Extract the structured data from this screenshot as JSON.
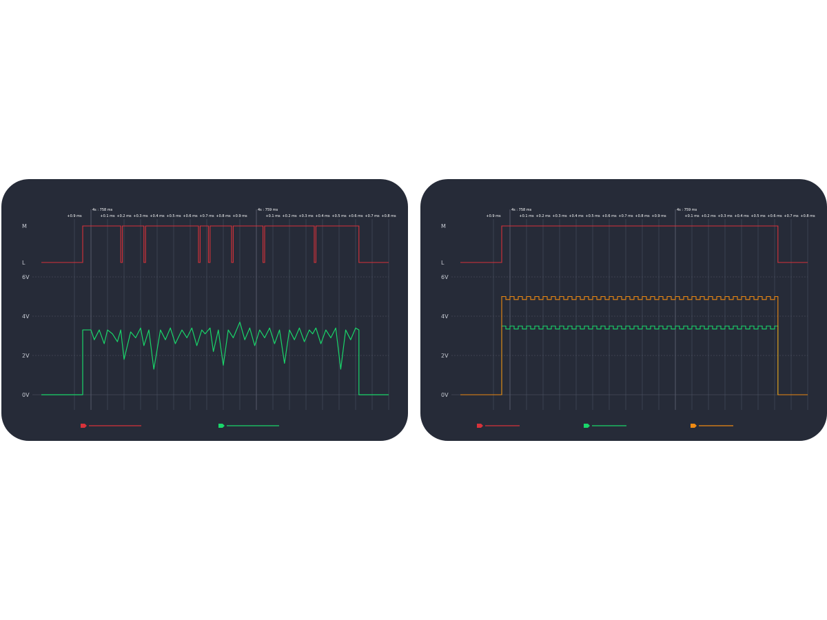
{
  "chart_data": [
    {
      "type": "line",
      "title": "",
      "time_axis": {
        "ticks_prev": [
          "+0.9 ms"
        ],
        "marker_1": "4s : 758 ms",
        "ticks_1": [
          "+0.1 ms",
          "+0.2 ms",
          "+0.3 ms",
          "+0.4 ms",
          "+0.5 ms",
          "+0.6 ms",
          "+0.7 ms",
          "+0.8 ms",
          "+0.9 ms"
        ],
        "marker_2": "4s : 759 ms",
        "ticks_2": [
          "+0.1 ms",
          "+0.2 ms",
          "+0.3 ms",
          "+0.4 ms",
          "+0.5 ms",
          "+0.6 ms",
          "+0.7 ms",
          "+0.8 ms"
        ]
      },
      "digital_axis": {
        "labels": [
          "M",
          "L"
        ]
      },
      "voltage_axis": {
        "labels": [
          "6V",
          "4V",
          "2V",
          "0V"
        ],
        "ylim": [
          0,
          6
        ]
      },
      "digital_series": {
        "color": "#d8323a",
        "x_ms": [
          -0.3,
          -0.05,
          -0.05,
          0.0,
          0.18,
          0.18,
          0.19,
          0.19,
          0.32,
          0.32,
          0.33,
          0.33,
          0.65,
          0.65,
          0.66,
          0.66,
          0.71,
          0.71,
          0.72,
          0.72,
          0.85,
          0.85,
          0.86,
          0.86,
          1.04,
          1.04,
          1.05,
          1.05,
          1.35,
          1.35,
          1.36,
          1.36,
          1.62,
          1.62,
          1.8
        ],
        "levels": [
          "L",
          "L",
          "M",
          "M",
          "M",
          "L",
          "L",
          "M",
          "M",
          "L",
          "L",
          "M",
          "M",
          "L",
          "L",
          "M",
          "M",
          "L",
          "L",
          "M",
          "M",
          "L",
          "L",
          "M",
          "M",
          "L",
          "L",
          "M",
          "M",
          "L",
          "L",
          "M",
          "M",
          "L",
          "L"
        ]
      },
      "analog_series": {
        "color": "#19d66a",
        "x_ms": [
          -0.3,
          -0.05,
          -0.05,
          0.0,
          0.02,
          0.05,
          0.08,
          0.1,
          0.13,
          0.16,
          0.18,
          0.2,
          0.24,
          0.27,
          0.3,
          0.32,
          0.35,
          0.38,
          0.42,
          0.45,
          0.48,
          0.51,
          0.55,
          0.58,
          0.61,
          0.64,
          0.67,
          0.69,
          0.72,
          0.74,
          0.77,
          0.8,
          0.83,
          0.86,
          0.9,
          0.93,
          0.96,
          0.99,
          1.02,
          1.05,
          1.08,
          1.11,
          1.14,
          1.17,
          1.2,
          1.23,
          1.26,
          1.29,
          1.32,
          1.34,
          1.36,
          1.39,
          1.42,
          1.45,
          1.48,
          1.51,
          1.54,
          1.57,
          1.6,
          1.62,
          1.62,
          1.8
        ],
        "values": [
          0,
          0,
          3.3,
          3.3,
          2.8,
          3.3,
          2.6,
          3.3,
          3.1,
          2.7,
          3.3,
          1.8,
          3.2,
          2.9,
          3.4,
          2.5,
          3.3,
          1.3,
          3.3,
          2.8,
          3.4,
          2.6,
          3.3,
          2.9,
          3.4,
          2.5,
          3.3,
          3.1,
          3.4,
          2.2,
          3.3,
          1.5,
          3.3,
          2.9,
          3.7,
          2.8,
          3.4,
          2.5,
          3.3,
          2.9,
          3.4,
          2.6,
          3.3,
          1.6,
          3.3,
          2.8,
          3.4,
          2.7,
          3.3,
          3.1,
          3.4,
          2.6,
          3.3,
          2.9,
          3.4,
          1.3,
          3.3,
          2.8,
          3.4,
          3.3,
          0,
          0
        ]
      },
      "legend": [
        {
          "color": "#d8323a"
        },
        {
          "color": "#19d66a"
        }
      ]
    },
    {
      "type": "line",
      "title": "",
      "time_axis": {
        "ticks_prev": [
          "+0.9 ms"
        ],
        "marker_1": "4s : 758 ms",
        "ticks_1": [
          "+0.1 ms",
          "+0.2 ms",
          "+0.3 ms",
          "+0.4 ms",
          "+0.5 ms",
          "+0.6 ms",
          "+0.7 ms",
          "+0.8 ms",
          "+0.9 ms"
        ],
        "marker_2": "4s : 759 ms",
        "ticks_2": [
          "+0.1 ms",
          "+0.2 ms",
          "+0.3 ms",
          "+0.4 ms",
          "+0.5 ms",
          "+0.6 ms",
          "+0.7 ms",
          "+0.8 ms"
        ]
      },
      "digital_axis": {
        "labels": [
          "M",
          "L"
        ]
      },
      "voltage_axis": {
        "labels": [
          "6V",
          "4V",
          "2V",
          "0V"
        ],
        "ylim": [
          0,
          6
        ]
      },
      "digital_series": {
        "color": "#d8323a",
        "x_ms": [
          -0.3,
          -0.05,
          -0.05,
          1.62,
          1.62,
          1.8
        ],
        "levels": [
          "L",
          "L",
          "M",
          "M",
          "L",
          "L"
        ]
      },
      "square_series": [
        {
          "color": "#19d66a",
          "high": 3.5,
          "low": 3.35,
          "period_ms": 0.05
        },
        {
          "color": "#ef8a12",
          "high": 5.0,
          "low": 4.85,
          "period_ms": 0.05
        }
      ],
      "square_window_ms": [
        -0.05,
        1.62
      ],
      "legend": [
        {
          "color": "#d8323a"
        },
        {
          "color": "#19d66a"
        },
        {
          "color": "#ef8a12"
        }
      ]
    }
  ]
}
